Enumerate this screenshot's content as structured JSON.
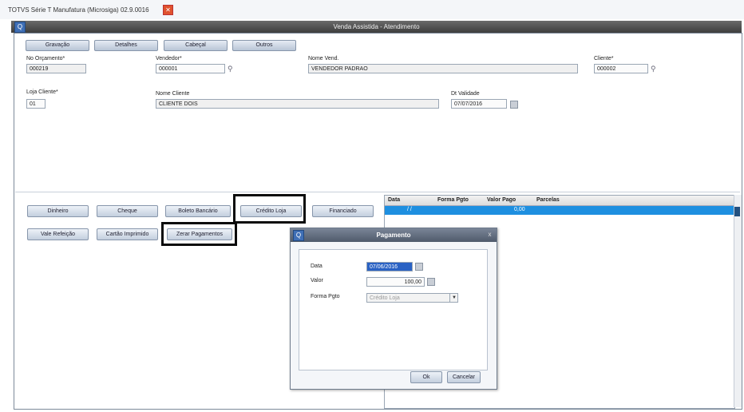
{
  "window": {
    "title": "TOTVS Série T Manufatura (Microsiga) 02.9.0016",
    "close_glyph": "✕",
    "app_icon": "Q"
  },
  "dialog_title": "Venda Assistida - Atendimento",
  "tabs": [
    "Gravação",
    "Detalhes",
    "Cabeçal",
    "Outros"
  ],
  "form": {
    "orcamento": {
      "label": "No Orçamento*",
      "value": "000219"
    },
    "vendedor": {
      "label": "Vendedor*",
      "value": "000001"
    },
    "nome_vend": {
      "label": "Nome Vend.",
      "value": "VENDEDOR PADRAO"
    },
    "cliente": {
      "label": "Cliente*",
      "value": "000002"
    },
    "loja": {
      "label": "Loja Cliente*",
      "value": "01"
    },
    "nome_cliente": {
      "label": "Nome Cliente",
      "value": "CLIENTE DOIS"
    },
    "validade": {
      "label": "Dt Validade",
      "value": "07/07/2016"
    }
  },
  "actions": {
    "row1": [
      "Dinheiro",
      "Cheque",
      "Boleto Bancário",
      "Crédito Loja",
      "Financiado"
    ],
    "row2": [
      "Vale Refeição",
      "Cartão Imprimido",
      "Zerar Pagamentos"
    ]
  },
  "grid": {
    "columns": [
      "Data",
      "Forma Pgto",
      "Valor Pago",
      "Parcelas"
    ],
    "row": {
      "data": "/ /",
      "forma": "",
      "valor": "0,00",
      "parcelas": ""
    }
  },
  "modal": {
    "title": "Pagamento",
    "icon": "Q",
    "close": "x",
    "data_label": "Data",
    "data_value": "07/06/2016",
    "valor_label": "Valor",
    "valor_value": "100,00",
    "forma_label": "Forma Pgto",
    "forma_value": "Crédito Loja",
    "ok_label": "Ok",
    "cancel_label": "Cancelar"
  },
  "icons": {
    "lookup": "search-icon",
    "calendar": "calendar-icon"
  },
  "colors": {
    "accent": "#1e8fe0",
    "highlight_border": "#0b0b0b",
    "header_dark": "#3d3d3d"
  }
}
